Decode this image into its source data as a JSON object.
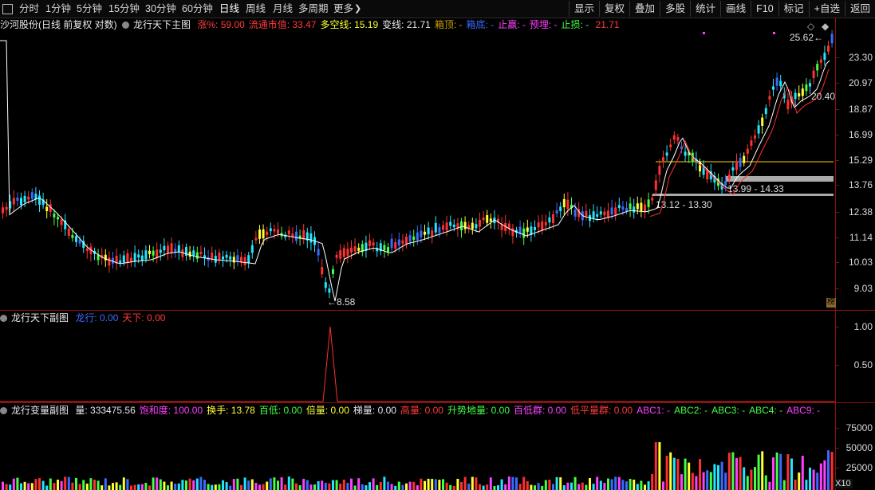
{
  "toolbar": {
    "left": [
      "分时",
      "1分钟",
      "5分钟",
      "15分钟",
      "30分钟",
      "60分钟",
      "日线",
      "周线",
      "月线",
      "多周期",
      "更多"
    ],
    "active": "日线",
    "right": [
      "显示",
      "复权",
      "叠加",
      "多股",
      "统计",
      "画线",
      "F10",
      "标记",
      "+自选",
      "返回"
    ]
  },
  "main": {
    "stock": "沙河股份(日线 前复权 对数)",
    "indicator": "龙行天下主图",
    "fields": [
      {
        "label": "涨%:",
        "value": "59.00",
        "color": "#ff3b3b"
      },
      {
        "label": "流通市值:",
        "value": "33.47",
        "color": "#ff3b3b"
      },
      {
        "label": "多空线:",
        "value": "15.19",
        "color": "#ffff33"
      },
      {
        "label": "变线:",
        "value": "21.71",
        "color": "#e8e8e8"
      },
      {
        "label": "箱顶:",
        "value": "-",
        "color": "#c8a000"
      },
      {
        "label": "箱底:",
        "value": "-",
        "color": "#3a6bff"
      },
      {
        "label": "止赢:",
        "value": "-",
        "color": "#ff40ff"
      },
      {
        "label": "预埋:",
        "value": "-",
        "color": "#ff40ff"
      },
      {
        "label": "止损:",
        "value": "-",
        "color": "#44ff44"
      },
      {
        "label": "",
        "value": "21.71",
        "color": "#ff3b3b"
      }
    ],
    "y_labels": [
      "23.30",
      "20.97",
      "18.87",
      "16.99",
      "15.29",
      "13.76",
      "12.38",
      "11.14",
      "10.03",
      "9.03"
    ],
    "annotations": {
      "high": "25.62",
      "low": "8.58",
      "ma_end": "20.40",
      "box1": "13.99 - 14.33",
      "box2": "13.12 - 13.30"
    },
    "corner_badge": "榜"
  },
  "sub1": {
    "title": "龙行天下副图",
    "fields": [
      {
        "label": "龙行:",
        "value": "0.00",
        "color": "#3a6bff"
      },
      {
        "label": "天下:",
        "value": "0.00",
        "color": "#ff3b3b"
      }
    ],
    "y_labels": [
      "1.00",
      "0.50"
    ]
  },
  "sub2": {
    "title": "龙行变量副图",
    "fields": [
      {
        "label": "量:",
        "value": "333475.56",
        "color": "#e8e8e8"
      },
      {
        "label": "饱和度:",
        "value": "100.00",
        "color": "#ff40ff"
      },
      {
        "label": "换手:",
        "value": "13.78",
        "color": "#ffff33"
      },
      {
        "label": "百低:",
        "value": "0.00",
        "color": "#44ff44"
      },
      {
        "label": "倍量:",
        "value": "0.00",
        "color": "#ffff33"
      },
      {
        "label": "梯量:",
        "value": "0.00",
        "color": "#e8e8e8"
      },
      {
        "label": "高量:",
        "value": "0.00",
        "color": "#ff3b3b"
      },
      {
        "label": "升势地量:",
        "value": "0.00",
        "color": "#44ff44"
      },
      {
        "label": "百低群:",
        "value": "0.00",
        "color": "#ff40ff"
      },
      {
        "label": "低平量群:",
        "value": "0.00",
        "color": "#ff3b3b"
      },
      {
        "label": "ABC1:",
        "value": "-",
        "color": "#ff40ff"
      },
      {
        "label": "ABC2:",
        "value": "-",
        "color": "#44ff44"
      },
      {
        "label": "ABC3:",
        "value": "-",
        "color": "#44ff44"
      },
      {
        "label": "ABC4:",
        "value": "-",
        "color": "#44ff44"
      },
      {
        "label": "ABC9:",
        "value": "-",
        "color": "#ff40ff"
      }
    ],
    "y_labels": [
      "75000",
      "50000",
      "25000"
    ],
    "unit": "X10"
  }
}
